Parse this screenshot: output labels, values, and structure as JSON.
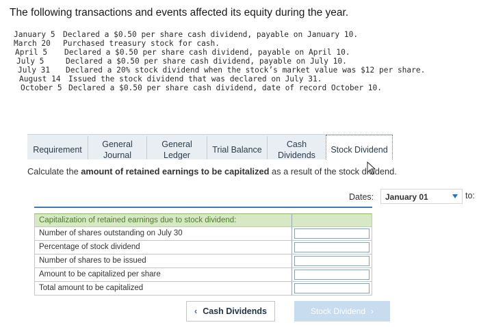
{
  "heading": "The following transactions and events affected its equity during the year.",
  "transactions": [
    {
      "date": "January 5",
      "text": "Declared a $0.50 per share cash dividend, payable on January 10."
    },
    {
      "date": "March 20",
      "text": "Purchased treasury stock for cash."
    },
    {
      "date": "April 5",
      "text": "Declared a $0.50 per share cash dividend, payable on April 10."
    },
    {
      "date": "July 5",
      "text": "Declared a $0.50 per share cash dividend, payable on July 10."
    },
    {
      "date": "July 31",
      "text": "Declared a 20% stock dividend when the stock’s market value was $12 per share."
    },
    {
      "date": "August 14",
      "text": "Issued the stock dividend that was declared on July 31."
    },
    {
      "date": "October 5",
      "text": "Declared a $0.50 per share cash dividend, date of record October 10."
    }
  ],
  "tabs": [
    {
      "label": "Requirement"
    },
    {
      "label": "General Journal"
    },
    {
      "label": "General Ledger"
    },
    {
      "label": "Trial Balance"
    },
    {
      "label": "Cash Dividends"
    },
    {
      "label": "Stock Dividend"
    }
  ],
  "instruction": {
    "prefix": "Calculate the ",
    "bold": "amount of retained earnings to be capitalized",
    "suffix": " as a result of the stock dividend."
  },
  "dates": {
    "label": "Dates:",
    "value": "January 01",
    "to": "to:"
  },
  "table": {
    "header": "Capitalization of retained earnings due to stock dividend:",
    "rows": [
      {
        "label": "Number of shares outstanding on July 30"
      },
      {
        "label": "Percentage of stock dividend"
      },
      {
        "label": "Number of shares to be issued"
      },
      {
        "label": "Amount to be capitalized per share"
      },
      {
        "label": "Total amount to be capitalized"
      }
    ]
  },
  "nav": {
    "prev_label": "Cash Dividends",
    "next_label": "Stock Dividend"
  },
  "colors": {
    "accent": "#2c6fc0",
    "header_green": "#d6e8c4",
    "tab_bg": "#e9eef2"
  }
}
